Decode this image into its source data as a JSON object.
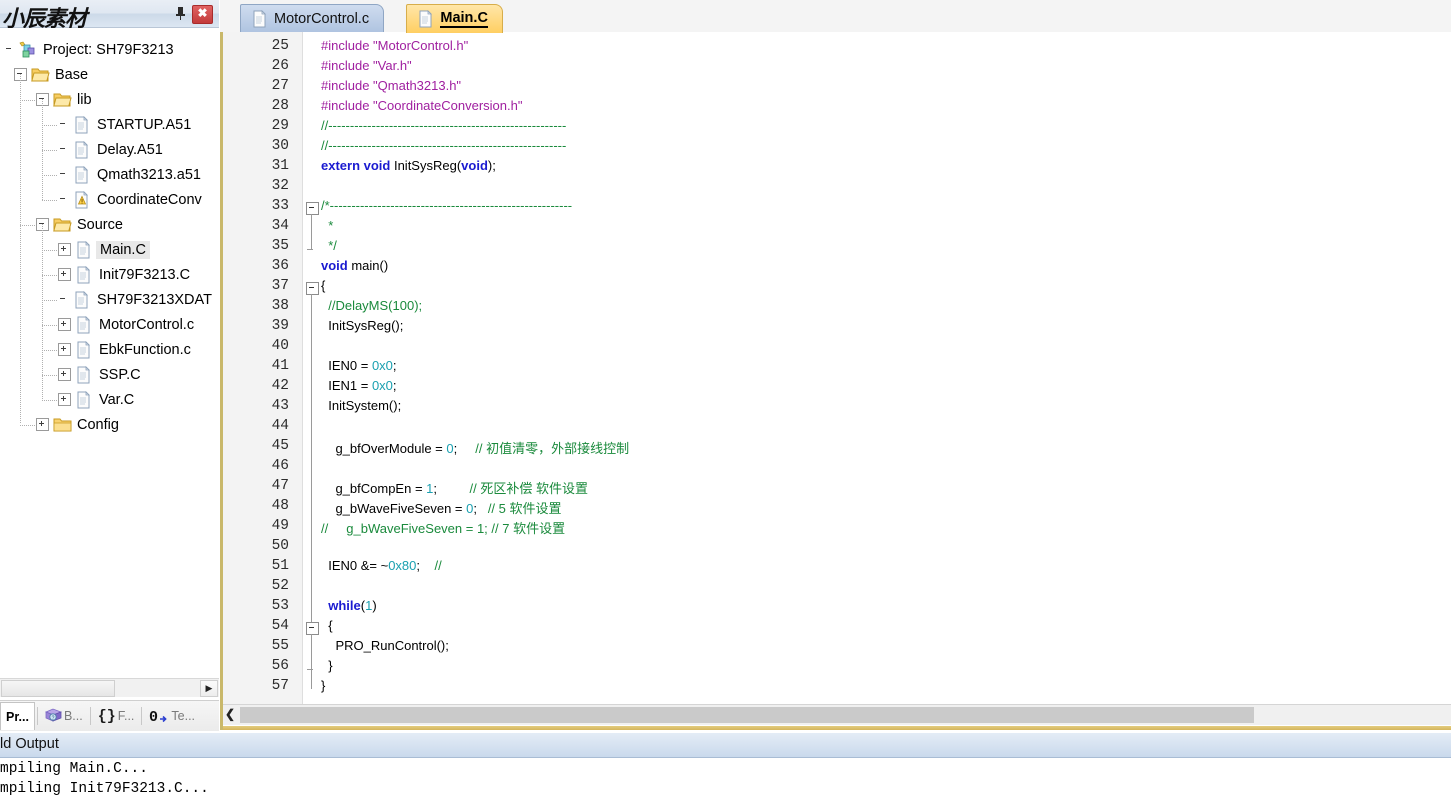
{
  "panel": {
    "title": "小辰素材",
    "pin_icon": "pin-icon",
    "close_label": "✖",
    "tree": [
      {
        "label": "Project: SH79F3213",
        "depth": 0,
        "icon": "project-icon",
        "expander": "none",
        "selected": false
      },
      {
        "label": "Base",
        "depth": 1,
        "icon": "folder-open-icon",
        "expander": "minus",
        "selected": false
      },
      {
        "label": "lib",
        "depth": 2,
        "icon": "folder-open-icon",
        "expander": "minus",
        "selected": false
      },
      {
        "label": "STARTUP.A51",
        "depth": 3,
        "icon": "file-icon",
        "expander": "none",
        "selected": false
      },
      {
        "label": "Delay.A51",
        "depth": 3,
        "icon": "file-icon",
        "expander": "none",
        "selected": false
      },
      {
        "label": "Qmath3213.a51",
        "depth": 3,
        "icon": "file-icon",
        "expander": "none",
        "selected": false
      },
      {
        "label": "CoordinateConv",
        "depth": 3,
        "icon": "warning-file-icon",
        "expander": "none",
        "selected": false
      },
      {
        "label": "Source",
        "depth": 2,
        "icon": "folder-open-icon",
        "expander": "minus",
        "selected": false
      },
      {
        "label": "Main.C",
        "depth": 3,
        "icon": "file-icon",
        "expander": "plus",
        "selected": true
      },
      {
        "label": "Init79F3213.C",
        "depth": 3,
        "icon": "file-icon",
        "expander": "plus",
        "selected": false
      },
      {
        "label": "SH79F3213XDAT",
        "depth": 3,
        "icon": "file-icon",
        "expander": "none",
        "selected": false
      },
      {
        "label": "MotorControl.c",
        "depth": 3,
        "icon": "file-icon",
        "expander": "plus",
        "selected": false
      },
      {
        "label": "EbkFunction.c",
        "depth": 3,
        "icon": "file-icon",
        "expander": "plus",
        "selected": false
      },
      {
        "label": "SSP.C",
        "depth": 3,
        "icon": "file-icon",
        "expander": "plus",
        "selected": false
      },
      {
        "label": "Var.C",
        "depth": 3,
        "icon": "file-icon",
        "expander": "plus",
        "selected": false
      },
      {
        "label": "Config",
        "depth": 2,
        "icon": "folder-closed-icon",
        "expander": "plus",
        "selected": false
      }
    ],
    "bottom_tabs": [
      {
        "label": "Pr...",
        "icon": "project-tab-icon",
        "active": true
      },
      {
        "label": "B...",
        "icon": "books-icon",
        "active": false
      },
      {
        "label": "F...",
        "icon": "braces-icon",
        "active": false
      },
      {
        "label": "Te...",
        "icon": "templates-icon",
        "active": false
      }
    ]
  },
  "editor": {
    "tabs": [
      {
        "label": "MotorControl.c",
        "icon": "file-icon",
        "active": false
      },
      {
        "label": "Main.C",
        "icon": "file-icon",
        "active": true
      }
    ],
    "first_line_number": 25,
    "lines": [
      {
        "n": 25,
        "tokens": [
          {
            "t": "#include ",
            "c": "pp"
          },
          {
            "t": "\"MotorControl.h\"",
            "c": "str"
          }
        ]
      },
      {
        "n": 26,
        "tokens": [
          {
            "t": "#include ",
            "c": "pp"
          },
          {
            "t": "\"Var.h\"",
            "c": "str"
          }
        ]
      },
      {
        "n": 27,
        "tokens": [
          {
            "t": "#include ",
            "c": "pp"
          },
          {
            "t": "\"Qmath3213.h\"",
            "c": "str"
          }
        ]
      },
      {
        "n": 28,
        "tokens": [
          {
            "t": "#include ",
            "c": "pp"
          },
          {
            "t": "\"CoordinateConversion.h\"",
            "c": "str"
          }
        ]
      },
      {
        "n": 29,
        "tokens": [
          {
            "t": "//-------------------------------------------------------",
            "c": "cmt"
          }
        ]
      },
      {
        "n": 30,
        "tokens": [
          {
            "t": "//-------------------------------------------------------",
            "c": "cmt"
          }
        ]
      },
      {
        "n": 31,
        "tokens": [
          {
            "t": "extern void ",
            "c": "kw"
          },
          {
            "t": "InitSysReg(",
            "c": "plain"
          },
          {
            "t": "void",
            "c": "kw"
          },
          {
            "t": ");",
            "c": "plain"
          }
        ]
      },
      {
        "n": 32,
        "tokens": []
      },
      {
        "n": 33,
        "tokens": [
          {
            "t": "/*--------------------------------------------------------",
            "c": "cmt"
          }
        ]
      },
      {
        "n": 34,
        "tokens": [
          {
            "t": "  *",
            "c": "cmt"
          }
        ]
      },
      {
        "n": 35,
        "tokens": [
          {
            "t": "  */",
            "c": "cmt"
          }
        ]
      },
      {
        "n": 36,
        "tokens": [
          {
            "t": "void ",
            "c": "kw"
          },
          {
            "t": "main()",
            "c": "plain"
          }
        ]
      },
      {
        "n": 37,
        "tokens": [
          {
            "t": "{",
            "c": "plain"
          }
        ]
      },
      {
        "n": 38,
        "tokens": [
          {
            "t": "  //DelayMS(100);",
            "c": "cmt"
          }
        ]
      },
      {
        "n": 39,
        "tokens": [
          {
            "t": "  InitSysReg();",
            "c": "plain"
          }
        ]
      },
      {
        "n": 40,
        "tokens": []
      },
      {
        "n": 41,
        "tokens": [
          {
            "t": "  IEN0 = ",
            "c": "plain"
          },
          {
            "t": "0x0",
            "c": "num"
          },
          {
            "t": ";",
            "c": "plain"
          }
        ]
      },
      {
        "n": 42,
        "tokens": [
          {
            "t": "  IEN1 = ",
            "c": "plain"
          },
          {
            "t": "0x0",
            "c": "num"
          },
          {
            "t": ";",
            "c": "plain"
          }
        ]
      },
      {
        "n": 43,
        "tokens": [
          {
            "t": "  InitSystem();",
            "c": "plain"
          }
        ]
      },
      {
        "n": 44,
        "tokens": []
      },
      {
        "n": 45,
        "tokens": [
          {
            "t": "    g_bfOverModule = ",
            "c": "plain"
          },
          {
            "t": "0",
            "c": "num"
          },
          {
            "t": ";     ",
            "c": "plain"
          },
          {
            "t": "// 初值清零，外部接线控制",
            "c": "cmt"
          }
        ]
      },
      {
        "n": 46,
        "tokens": []
      },
      {
        "n": 47,
        "tokens": [
          {
            "t": "    g_bfCompEn = ",
            "c": "plain"
          },
          {
            "t": "1",
            "c": "num"
          },
          {
            "t": ";         ",
            "c": "plain"
          },
          {
            "t": "// 死区补偿 软件设置",
            "c": "cmt"
          }
        ]
      },
      {
        "n": 48,
        "tokens": [
          {
            "t": "    g_bWaveFiveSeven = ",
            "c": "plain"
          },
          {
            "t": "0",
            "c": "num"
          },
          {
            "t": ";   ",
            "c": "plain"
          },
          {
            "t": "// 5 软件设置",
            "c": "cmt"
          }
        ]
      },
      {
        "n": 49,
        "tokens": [
          {
            "t": "//     g_bWaveFiveSeven = 1; // 7 软件设置",
            "c": "cmt"
          }
        ]
      },
      {
        "n": 50,
        "tokens": []
      },
      {
        "n": 51,
        "tokens": [
          {
            "t": "  IEN0 &= ~",
            "c": "plain"
          },
          {
            "t": "0x80",
            "c": "num"
          },
          {
            "t": ";    ",
            "c": "plain"
          },
          {
            "t": "//",
            "c": "cmt"
          }
        ]
      },
      {
        "n": 52,
        "tokens": []
      },
      {
        "n": 53,
        "tokens": [
          {
            "t": "  while",
            "c": "kw"
          },
          {
            "t": "(",
            "c": "plain"
          },
          {
            "t": "1",
            "c": "num"
          },
          {
            "t": ")",
            "c": "plain"
          }
        ]
      },
      {
        "n": 54,
        "tokens": [
          {
            "t": "  {",
            "c": "plain"
          }
        ]
      },
      {
        "n": 55,
        "tokens": [
          {
            "t": "    PRO_RunControl();",
            "c": "plain"
          }
        ]
      },
      {
        "n": 56,
        "tokens": [
          {
            "t": "  }",
            "c": "plain"
          }
        ]
      },
      {
        "n": 57,
        "tokens": [
          {
            "t": "}",
            "c": "plain"
          }
        ]
      }
    ]
  },
  "output": {
    "title": "ld Output",
    "lines": [
      "mpiling Main.C...",
      "mpiling Init79F3213.C..."
    ]
  },
  "colors": {
    "keyword": "#1a1ad0",
    "preprocessor": "#a020a0",
    "string": "#a020a0",
    "comment": "#1a8a3c",
    "number": "#1aa0b0",
    "active_tab": "#ffcf62",
    "inactive_tab": "#aec3e0",
    "panel_title_bg": "#dfe7f1"
  }
}
